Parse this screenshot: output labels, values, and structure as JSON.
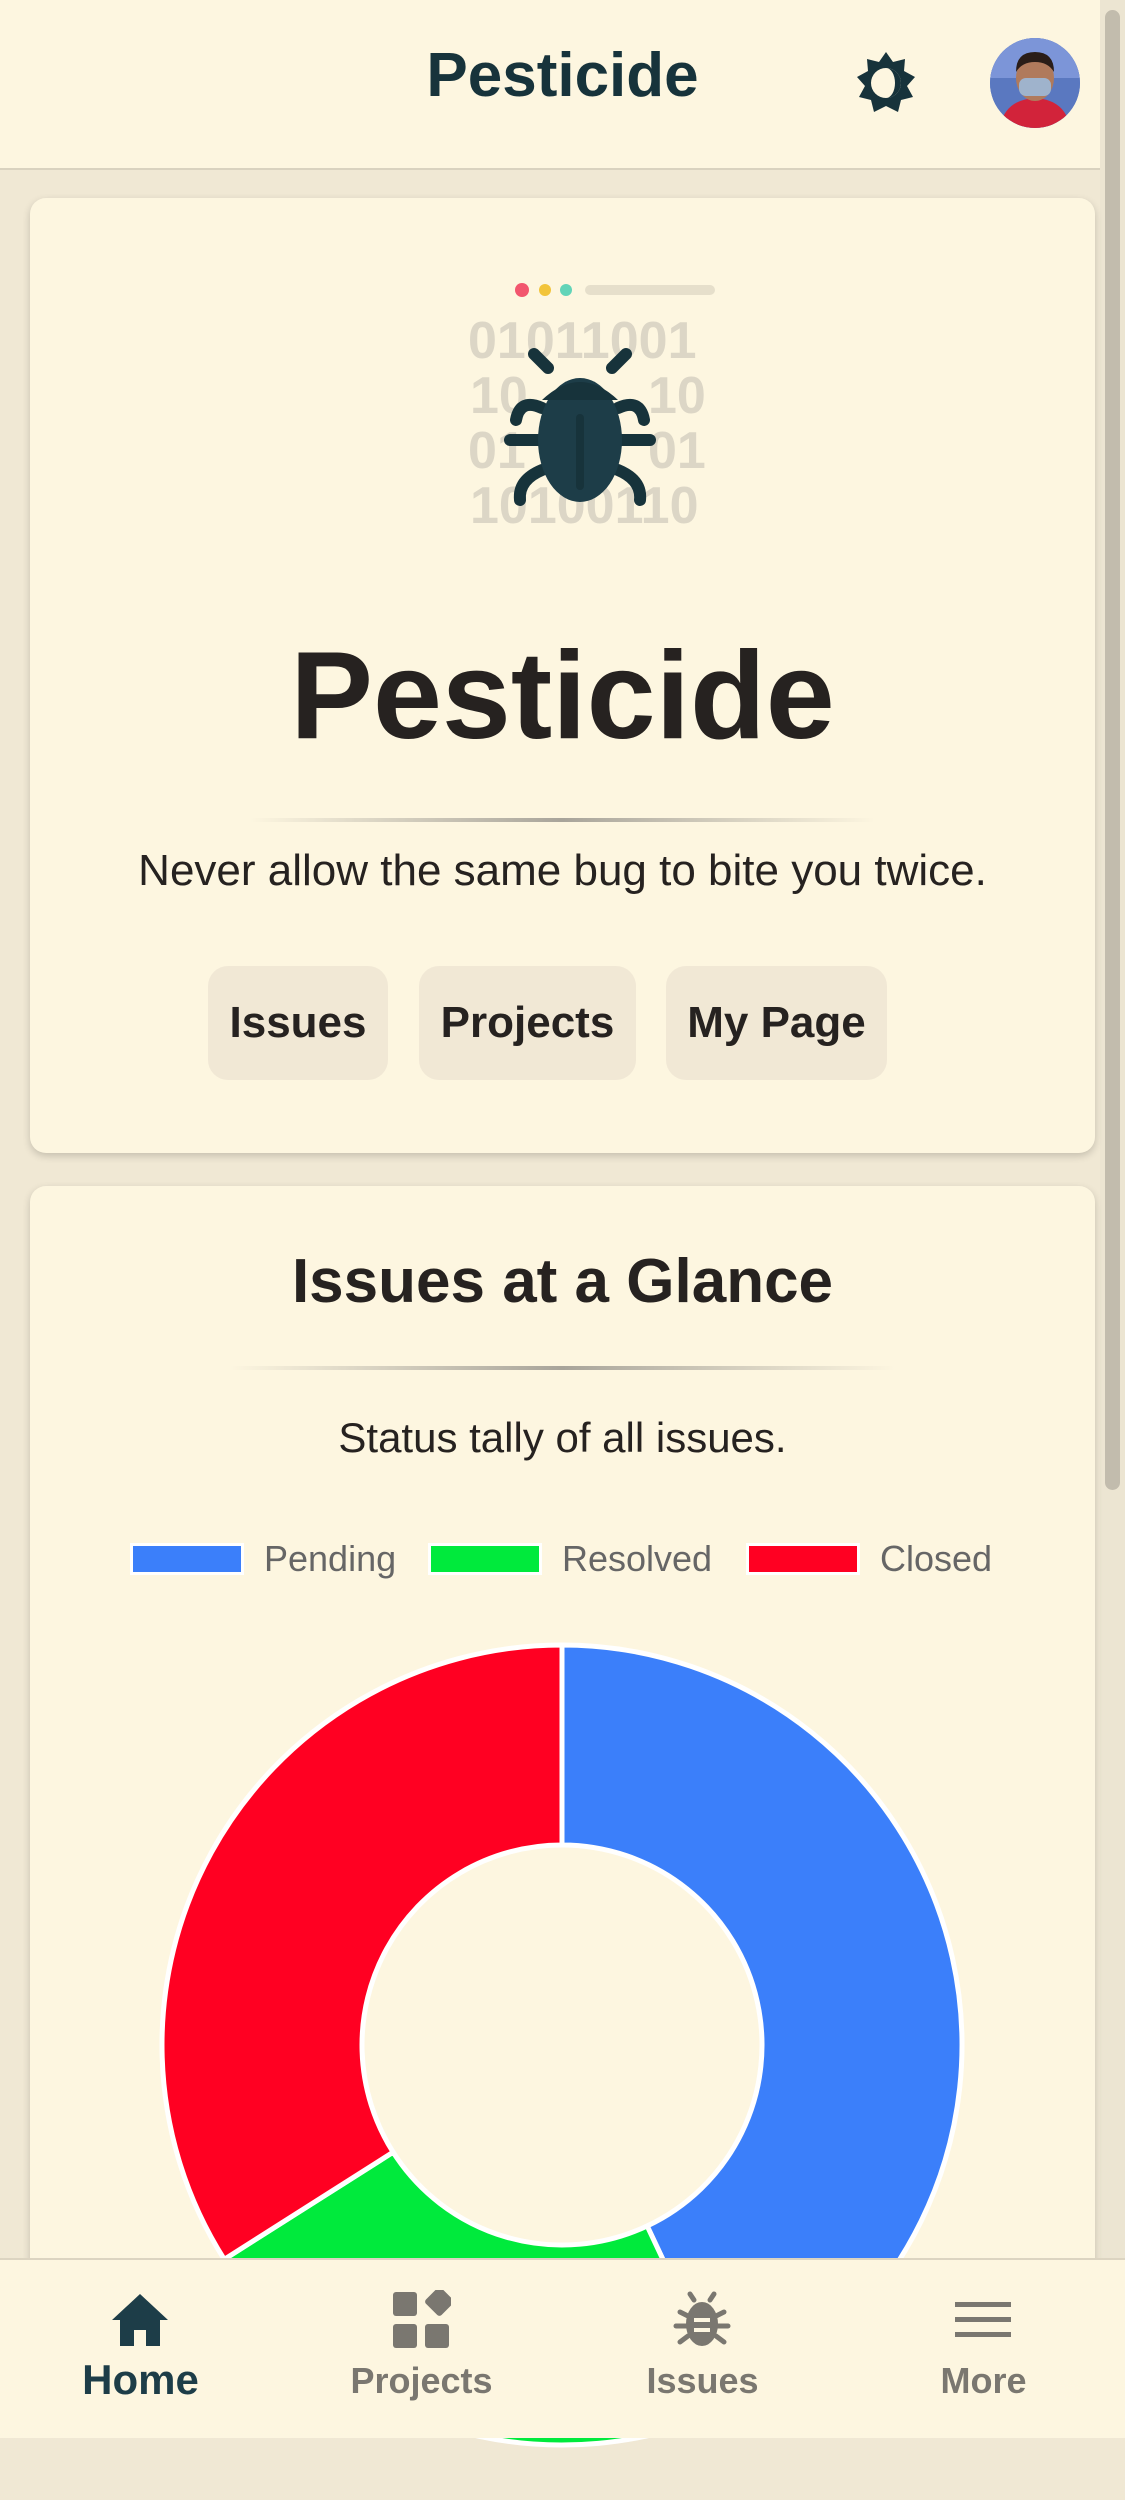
{
  "header": {
    "title": "Pesticide",
    "theme_toggle_icon": "contrast-icon",
    "avatar_icon": "user-avatar"
  },
  "hero": {
    "illustration_binary": [
      "01011001",
      "10",
      "10",
      "01",
      "01",
      "10100110"
    ],
    "title": "Pesticide",
    "tagline": "Never allow the same bug to bite you twice.",
    "buttons": [
      "Issues",
      "Projects",
      "My Page"
    ]
  },
  "glance": {
    "title": "Issues at a Glance",
    "subtitle": "Status tally of all issues.",
    "chart_data": {
      "type": "pie",
      "donut": true,
      "categories": [
        "Pending",
        "Resolved",
        "Closed"
      ],
      "values": [
        43,
        23,
        34
      ],
      "colors": [
        "#3b7ffa",
        "#00ea3c",
        "#ff0022"
      ],
      "legend": "top"
    }
  },
  "bottom_nav": {
    "items": [
      {
        "label": "Home",
        "icon": "home-icon",
        "active": true
      },
      {
        "label": "Projects",
        "icon": "grid-icon",
        "active": false
      },
      {
        "label": "Issues",
        "icon": "bug-icon",
        "active": false
      },
      {
        "label": "More",
        "icon": "menu-icon",
        "active": false
      }
    ]
  },
  "colors": {
    "background": "#f0e8d4",
    "card": "#fdf6e0",
    "brand_dark": "#17333b",
    "text": "#262220"
  }
}
